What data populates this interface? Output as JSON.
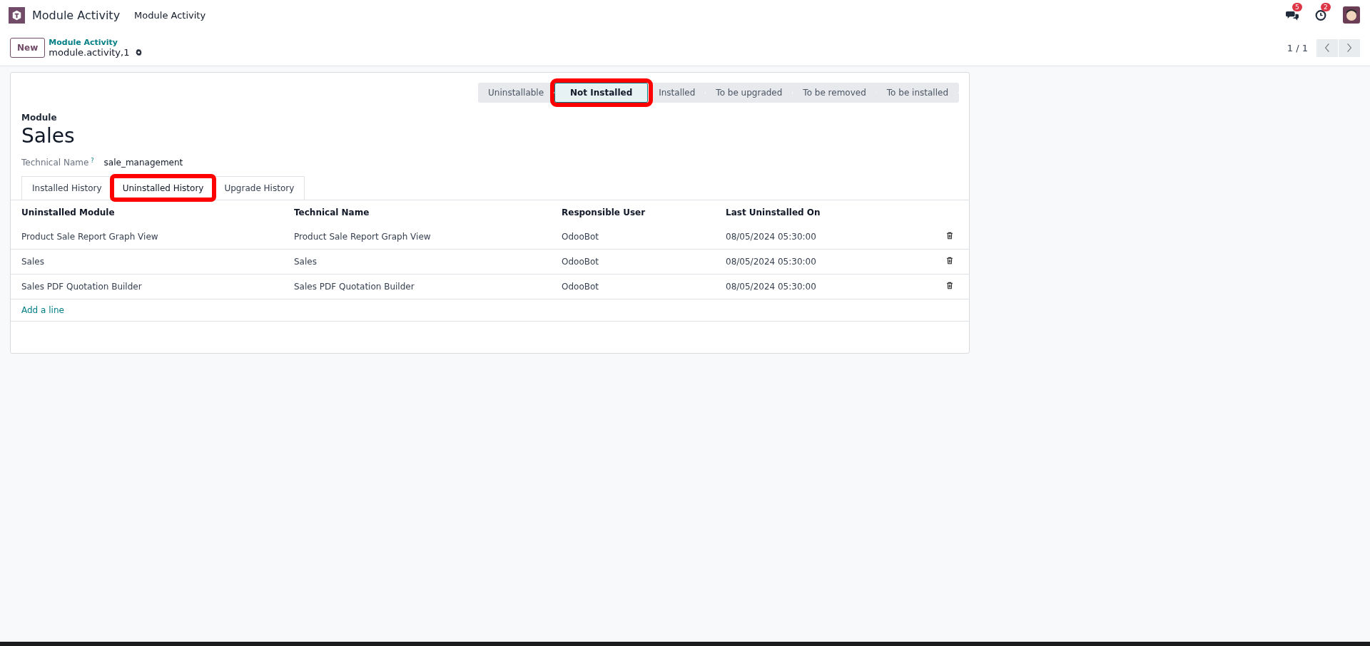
{
  "navbar": {
    "app_name": "Module Activity",
    "menu": [
      "Module Activity"
    ],
    "messages_badge": "5",
    "activities_badge": "2"
  },
  "control_panel": {
    "new_button": "New",
    "breadcrumb": "Module Activity",
    "record_name": "module.activity,1",
    "pager": "1 / 1"
  },
  "statusbar": [
    {
      "label": "Uninstallable",
      "selected": false,
      "highlighted": false
    },
    {
      "label": "Not Installed",
      "selected": true,
      "highlighted": true
    },
    {
      "label": "Installed",
      "selected": false,
      "highlighted": false
    },
    {
      "label": "To be upgraded",
      "selected": false,
      "highlighted": false
    },
    {
      "label": "To be removed",
      "selected": false,
      "highlighted": false
    },
    {
      "label": "To be installed",
      "selected": false,
      "highlighted": false
    }
  ],
  "form": {
    "module_label": "Module",
    "module_name": "Sales",
    "technical_name_label": "Technical Name",
    "help_mark": "?",
    "technical_name": "sale_management"
  },
  "tabs": [
    {
      "label": "Installed History",
      "selected": false,
      "highlighted": false
    },
    {
      "label": "Uninstalled History",
      "selected": true,
      "highlighted": true
    },
    {
      "label": "Upgrade History",
      "selected": false,
      "highlighted": false
    }
  ],
  "table": {
    "columns": [
      "Uninstalled Module",
      "Technical Name",
      "Responsible User",
      "Last Uninstalled On"
    ],
    "rows": [
      [
        "Product Sale Report Graph View",
        "Product Sale Report Graph View",
        "OdooBot",
        "08/05/2024 05:30:00"
      ],
      [
        "Sales",
        "Sales",
        "OdooBot",
        "08/05/2024 05:30:00"
      ],
      [
        "Sales PDF Quotation Builder",
        "Sales PDF Quotation Builder",
        "OdooBot",
        "08/05/2024 05:30:00"
      ]
    ],
    "add_line": "Add a line"
  }
}
